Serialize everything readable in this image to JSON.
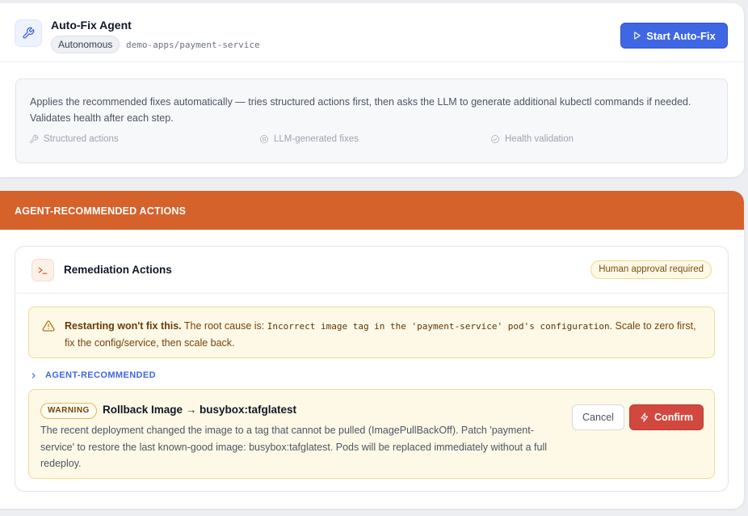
{
  "agent": {
    "icon": "wrench-icon",
    "title": "Auto-Fix Agent",
    "mode_badge": "Autonomous",
    "repo": "demo-apps/payment-service",
    "start_button": "Start Auto-Fix",
    "start_icon": "play-icon",
    "description": "Applies the recommended fixes automatically — tries structured actions first, then asks the LLM to generate additional kubectl commands if needed. Validates health after each step.",
    "features": [
      {
        "label": "Structured actions",
        "icon": "wrench-icon"
      },
      {
        "label": "LLM-generated fixes",
        "icon": "cpu-icon"
      },
      {
        "label": "Health validation",
        "icon": "check-circle-icon"
      }
    ]
  },
  "recommended": {
    "header": "AGENT-RECOMMENDED ACTIONS",
    "card_title": "Remediation Actions",
    "card_icon": "terminal-icon",
    "approval_badge": "Human approval required",
    "warning": {
      "icon": "alert-triangle-icon",
      "bold": "Restarting won't fix this.",
      "prefix": " The root cause is: ",
      "code": "Incorrect image tag in the 'payment-service' pod's configuration",
      "suffix": ". Scale to zero first, fix the config/service, then scale back."
    },
    "section_toggle": "AGENT-RECOMMENDED",
    "action": {
      "severity": "WARNING",
      "title": "Rollback Image → busybox:tafglatest",
      "description": "The recent deployment changed the image to a tag that cannot be pulled (ImagePullBackOff). Patch 'payment-service' to restore the last known-good image: busybox:tafglatest. Pods will be replaced immediately without a full redeploy.",
      "cancel": "Cancel",
      "confirm": "Confirm",
      "confirm_icon": "lightning-icon"
    }
  },
  "colors": {
    "accent_blue": "#4067e3",
    "header_orange": "#d5612b",
    "confirm_red": "#d2483f",
    "warning_bg": "#fef9e6"
  }
}
